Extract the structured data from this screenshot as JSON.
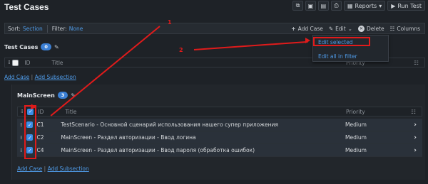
{
  "header": {
    "title": "Test Cases",
    "reports_label": "Reports",
    "run_test_label": "Run Test"
  },
  "toolbar": {
    "sort_label": "Sort:",
    "sort_value": "Section",
    "filter_label": "Filter:",
    "filter_value": "None",
    "add_case": "Add Case",
    "edit": "Edit",
    "delete": "Delete",
    "columns": "Columns"
  },
  "edit_menu": {
    "items": [
      "Edit selected",
      "Edit all in filter"
    ]
  },
  "root_section": {
    "title": "Test Cases",
    "count": "0",
    "columns": [
      "ID",
      "Title",
      "Priority"
    ],
    "links": {
      "add_case": "Add Case",
      "separator": "|",
      "add_subsection": "Add Subsection"
    }
  },
  "main_section": {
    "title": "MainScreen",
    "count": "3",
    "columns": [
      "ID",
      "Title",
      "Priority"
    ],
    "rows": [
      {
        "id": "C1",
        "title": "TestScenario - Основной сценарий использования нашего супер приложения",
        "priority": "Medium"
      },
      {
        "id": "C2",
        "title": "MainScreen - Раздел авторизации - Ввод логина",
        "priority": "Medium"
      },
      {
        "id": "C4",
        "title": "MainScreen - Раздел авторизации - Ввод пароля (обработка ошибок)",
        "priority": "Medium"
      }
    ],
    "links": {
      "add_case": "Add Case",
      "separator": "|",
      "add_subsection": "Add Subsection"
    }
  },
  "annotations": {
    "label_1": "1",
    "label_2": "2",
    "color": "#e01b1b"
  },
  "colors": {
    "background": "#1e2227",
    "link": "#4f9be8",
    "checkbox": "#3b8ee8",
    "selected_row": "#2a313a"
  }
}
